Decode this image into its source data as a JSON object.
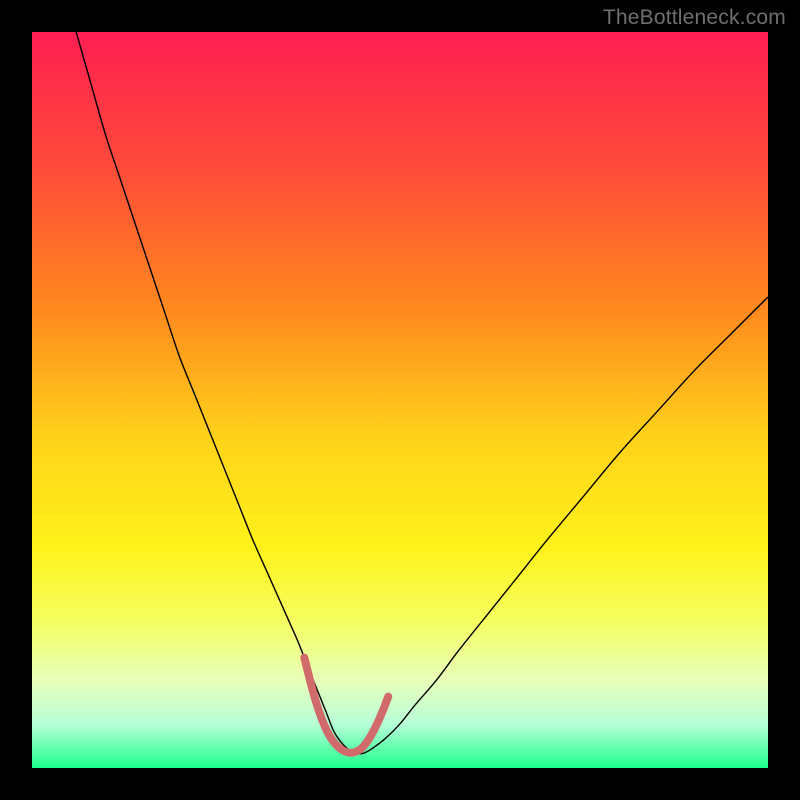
{
  "watermark": "TheBottleneck.com",
  "chart_data": {
    "type": "line",
    "title": "",
    "xlabel": "",
    "ylabel": "",
    "xlim": [
      0,
      100
    ],
    "ylim": [
      0,
      100
    ],
    "grid": false,
    "legend": false,
    "background_gradient": {
      "stops": [
        {
          "t": 0.0,
          "color": "#ff1e52"
        },
        {
          "t": 0.18,
          "color": "#ff4a3a"
        },
        {
          "t": 0.38,
          "color": "#ff8a1e"
        },
        {
          "t": 0.55,
          "color": "#ffd21a"
        },
        {
          "t": 0.7,
          "color": "#fff21a"
        },
        {
          "t": 0.8,
          "color": "#f6ff60"
        },
        {
          "t": 0.88,
          "color": "#e8ffb8"
        },
        {
          "t": 0.94,
          "color": "#b8ffd8"
        },
        {
          "t": 1.0,
          "color": "#1cff8c"
        }
      ]
    },
    "series": [
      {
        "name": "bottleneck-curve",
        "stroke": "#000000",
        "stroke_width": 1.4,
        "x": [
          6,
          8,
          10,
          12,
          14,
          16,
          18,
          20,
          22,
          24,
          26,
          28,
          30,
          32,
          34,
          36,
          37,
          38,
          39,
          40,
          41,
          42,
          43,
          44,
          45,
          46,
          48,
          50,
          52,
          55,
          58,
          62,
          66,
          70,
          75,
          80,
          85,
          90,
          95,
          100
        ],
        "y": [
          100,
          93,
          86,
          80,
          74,
          68,
          62,
          56,
          51,
          46,
          41,
          36,
          31,
          26.5,
          22,
          17.5,
          15,
          12.5,
          10,
          7.5,
          5,
          3.5,
          2.5,
          2,
          2,
          2.5,
          4,
          6,
          8.5,
          12,
          16,
          21,
          26,
          31,
          37,
          43,
          48.5,
          54,
          59,
          64
        ]
      },
      {
        "name": "valley-highlight",
        "stroke": "#d16a6a",
        "stroke_width": 8,
        "linecap": "round",
        "x": [
          37.0,
          37.6,
          38.2,
          38.8,
          39.4,
          40.0,
          40.6,
          41.2,
          41.8,
          42.4,
          43.0,
          43.6,
          44.2,
          44.8,
          45.4,
          46.0,
          46.6,
          47.2,
          47.8,
          48.4
        ],
        "y": [
          15.0,
          12.6,
          10.3,
          8.3,
          6.6,
          5.2,
          4.1,
          3.3,
          2.7,
          2.3,
          2.1,
          2.1,
          2.3,
          2.7,
          3.4,
          4.3,
          5.4,
          6.7,
          8.1,
          9.7
        ]
      }
    ]
  }
}
